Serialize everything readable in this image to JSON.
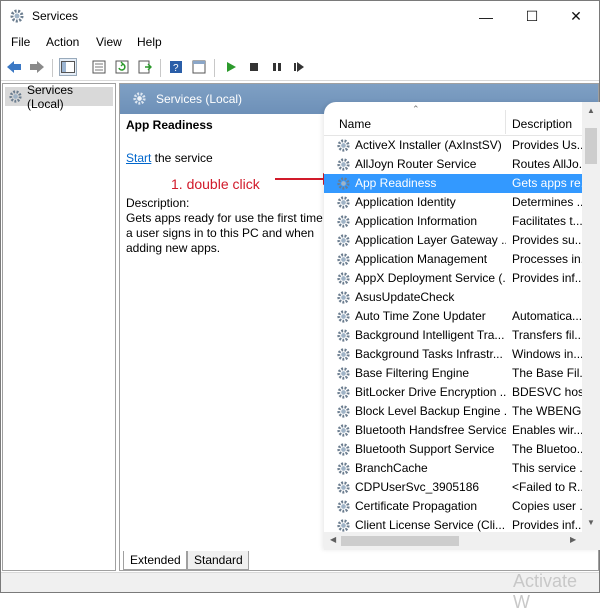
{
  "window": {
    "title": "Services"
  },
  "menu": [
    "File",
    "Action",
    "View",
    "Help"
  ],
  "tree": {
    "root": "Services (Local)"
  },
  "panel": {
    "header": "Services (Local)",
    "selected_title": "App Readiness",
    "start_link": "Start",
    "start_suffix": " the service",
    "description_label": "Description:",
    "description_text": "Gets apps ready for use the first time a user signs in to this PC and when adding new apps."
  },
  "annotation": {
    "text": "1. double click",
    "color": "#d11a2a"
  },
  "list": {
    "columns": {
      "name": "Name",
      "description": "Description"
    },
    "rows": [
      {
        "name": "ActiveX Installer (AxInstSV)",
        "desc": "Provides Us..."
      },
      {
        "name": "AllJoyn Router Service",
        "desc": "Routes AllJo..."
      },
      {
        "name": "App Readiness",
        "desc": "Gets apps re...",
        "selected": true
      },
      {
        "name": "Application Identity",
        "desc": "Determines ..."
      },
      {
        "name": "Application Information",
        "desc": "Facilitates t..."
      },
      {
        "name": "Application Layer Gateway ...",
        "desc": "Provides su..."
      },
      {
        "name": "Application Management",
        "desc": "Processes in..."
      },
      {
        "name": "AppX Deployment Service (...",
        "desc": "Provides inf..."
      },
      {
        "name": "AsusUpdateCheck",
        "desc": ""
      },
      {
        "name": "Auto Time Zone Updater",
        "desc": "Automatica..."
      },
      {
        "name": "Background Intelligent Tra...",
        "desc": "Transfers fil..."
      },
      {
        "name": "Background Tasks Infrastr...",
        "desc": "Windows in..."
      },
      {
        "name": "Base Filtering Engine",
        "desc": "The Base Fil..."
      },
      {
        "name": "BitLocker Drive Encryption ...",
        "desc": "BDESVC hos..."
      },
      {
        "name": "Block Level Backup Engine ...",
        "desc": "The WBENG..."
      },
      {
        "name": "Bluetooth Handsfree Service",
        "desc": "Enables wir..."
      },
      {
        "name": "Bluetooth Support Service",
        "desc": "The Bluetoo..."
      },
      {
        "name": "BranchCache",
        "desc": "This service ..."
      },
      {
        "name": "CDPUserSvc_3905186",
        "desc": "<Failed to R..."
      },
      {
        "name": "Certificate Propagation",
        "desc": "Copies user ..."
      },
      {
        "name": "Client License Service (Cli...",
        "desc": "Provides inf..."
      }
    ]
  },
  "tabs": [
    "Extended",
    "Standard"
  ],
  "watermark": "Activate W",
  "colors": {
    "selection": "#3399ff",
    "header": "#6d90b8",
    "link": "#0066cc"
  }
}
